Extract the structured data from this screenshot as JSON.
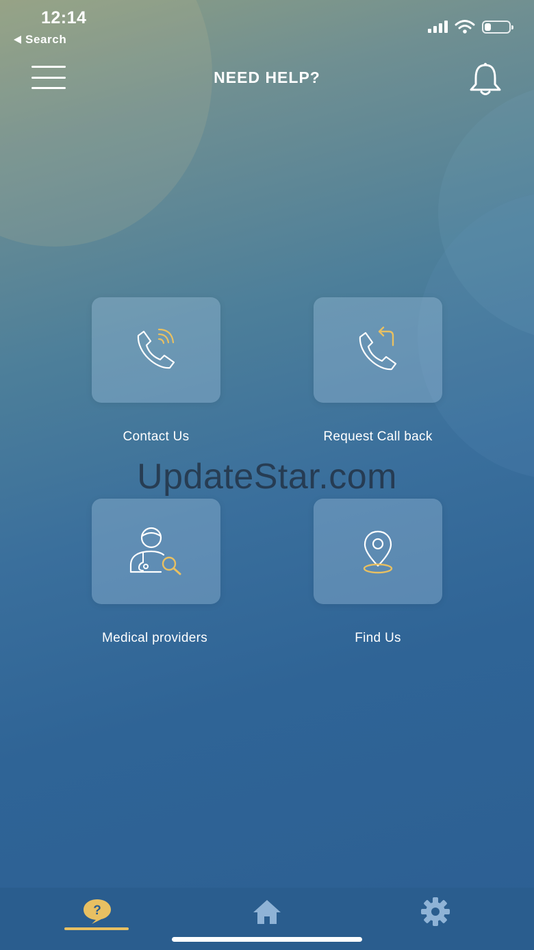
{
  "status_bar": {
    "time": "12:14",
    "back_label": "Search"
  },
  "header": {
    "title": "NEED HELP?",
    "menu_icon": "hamburger-menu-icon",
    "bell_icon": "bell-icon"
  },
  "tiles": [
    {
      "label": "Contact Us",
      "icon": "phone-ringing-icon"
    },
    {
      "label": "Request Call back",
      "icon": "phone-callback-icon"
    },
    {
      "label": "Medical providers",
      "icon": "doctor-search-icon"
    },
    {
      "label": "Find Us",
      "icon": "location-pin-icon"
    }
  ],
  "watermark": "UpdateStar.com",
  "bottom_nav": {
    "items": [
      {
        "icon": "help-bubble-icon",
        "active": true
      },
      {
        "icon": "home-icon",
        "active": false
      },
      {
        "icon": "gear-icon",
        "active": false
      }
    ]
  },
  "colors": {
    "accent": "#e8c062",
    "nav_background": "#2a5d8e",
    "nav_inactive": "#8fb3d6",
    "icon_line": "#ffffff"
  }
}
